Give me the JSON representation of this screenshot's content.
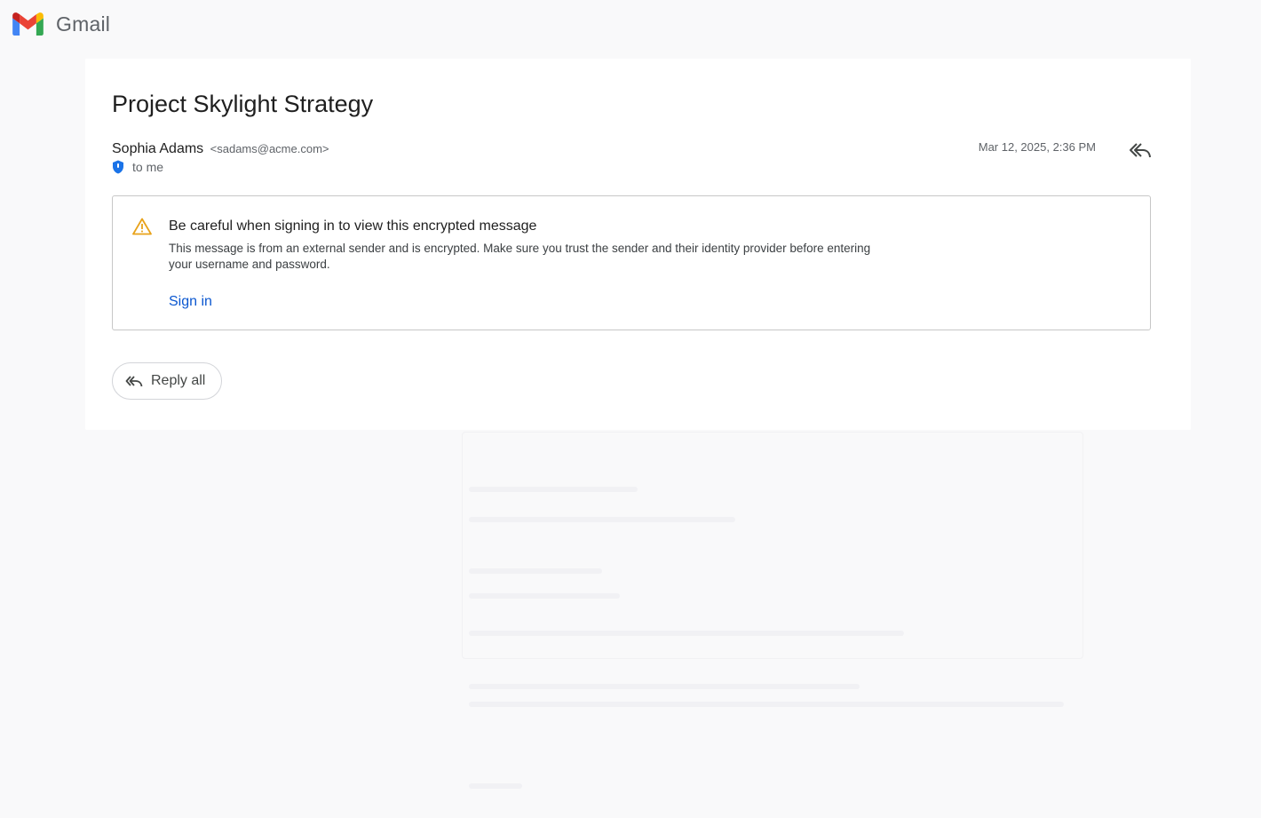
{
  "app": {
    "name": "Gmail",
    "logo_icon": "gmail-logo-icon"
  },
  "message": {
    "subject": "Project Skylight Strategy",
    "sender_name": "Sophia Adams",
    "sender_email": "<sadams@acme.com>",
    "recipient": "to me",
    "date": "Mar 12, 2025, 2:36 PM"
  },
  "warning": {
    "title": "Be careful when signing in to view this encrypted message",
    "body": "This message is from an external sender and is encrypted. Make sure you trust the sender and their identity provider before entering your username and password.",
    "sign_in_label": "Sign in",
    "icon": "warning-triangle-icon",
    "accent_color": "#e8a21a"
  },
  "actions": {
    "reply_all_label": "Reply all",
    "reply_all_icon": "reply-all-icon"
  },
  "colors": {
    "link": "#0b57d0",
    "shield": "#1a73e8"
  }
}
